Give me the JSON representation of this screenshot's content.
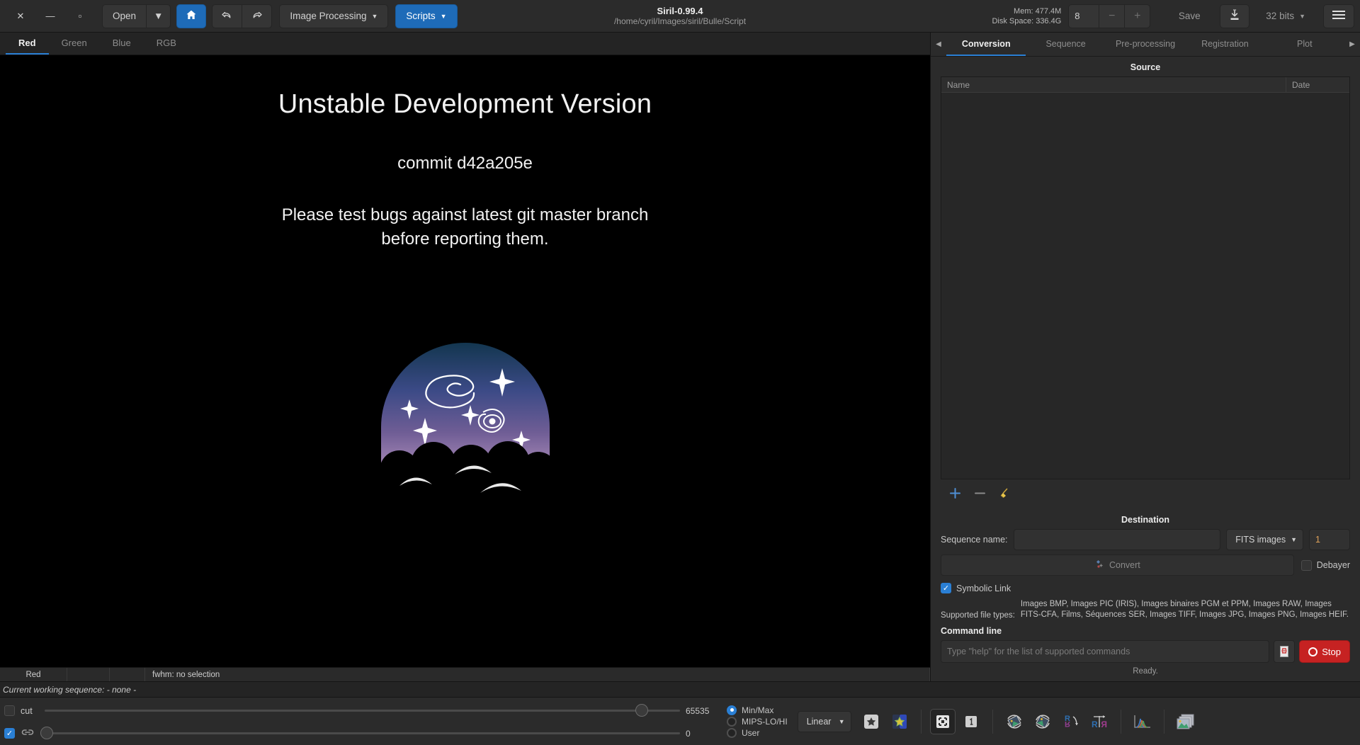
{
  "window": {
    "close_label": "✕",
    "minimize_label": "—",
    "maximize_label": "▫",
    "title": "Siril-0.99.4",
    "subtitle": "/home/cyril/Images/siril/Bulle/Script"
  },
  "toolbar": {
    "open_label": "Open",
    "open_dropdown_label": "▼",
    "home_icon": "home-icon",
    "undo_icon": "undo-icon",
    "redo_icon": "redo-icon",
    "image_processing_label": "Image Processing",
    "scripts_label": "Scripts",
    "caret": "▼"
  },
  "header_right": {
    "mem_label": "Mem: 477.4M",
    "disk_label": "Disk Space: 336.4G",
    "spin_value": "8",
    "minus_label": "−",
    "plus_label": "+",
    "save_label": "Save",
    "saveas_icon": "save-as-icon",
    "bitdepth_label": "32 bits",
    "bitdepth_caret": "▼",
    "menu_icon": "hamburger-menu-icon"
  },
  "channel_tabs": [
    {
      "label": "Red",
      "active": true
    },
    {
      "label": "Green",
      "active": false
    },
    {
      "label": "Blue",
      "active": false
    },
    {
      "label": "RGB",
      "active": false
    }
  ],
  "splash": {
    "headline": "Unstable Development Version",
    "commit": "commit d42a205e",
    "notice_line1": "Please test bugs against latest git master branch",
    "notice_line2": "before reporting them.",
    "logo_name": "siril-logo"
  },
  "image_status": {
    "channel": "Red",
    "col2": "",
    "col3": "",
    "fwhm": "fwhm: no selection"
  },
  "panel_tabs": {
    "prev_arrow": "◀",
    "next_arrow": "▶",
    "items": [
      {
        "label": "Conversion",
        "active": true
      },
      {
        "label": "Sequence",
        "active": false
      },
      {
        "label": "Pre-processing",
        "active": false
      },
      {
        "label": "Registration",
        "active": false
      },
      {
        "label": "Plot",
        "active": false
      }
    ]
  },
  "source": {
    "title": "Source",
    "columns": [
      "Name",
      "Date"
    ],
    "rows": [],
    "add_icon": "plus-icon",
    "remove_icon": "minus-icon",
    "clear_icon": "broom-icon"
  },
  "destination": {
    "title": "Destination",
    "sequence_name_label": "Sequence name:",
    "sequence_name_value": "",
    "sequence_name_placeholder": "",
    "format_value": "FITS images",
    "format_caret": "▼",
    "start_index": "1",
    "convert_label": "Convert",
    "convert_icon": "convert-icon",
    "debayer_label": "Debayer",
    "debayer_checked": false,
    "symbolic_link_label": "Symbolic Link",
    "symbolic_link_checked": true,
    "supported_label": "Supported file types:",
    "supported_value": "Images BMP, Images PIC (IRIS), Images binaires PGM et PPM, Images RAW, Images FITS-CFA, Films, Séquences SER, Images TIFF, Images JPG, Images PNG, Images HEIF."
  },
  "command_line": {
    "title": "Command line",
    "placeholder": "Type \"help\" for the list of supported commands",
    "value": "",
    "script_icon": "script-icon",
    "stop_label": "Stop",
    "status": "Ready."
  },
  "sequence_status": {
    "text": "Current working sequence: - none -"
  },
  "bottom": {
    "cut_label": "cut",
    "cut_checked": false,
    "link_checked": true,
    "link_icon": "chain-link-icon",
    "hi_value": "65535",
    "lo_value": "0",
    "hi_percent": 93,
    "lo_percent": 0,
    "display_modes": [
      {
        "label": "Min/Max",
        "selected": true
      },
      {
        "label": "MIPS-LO/HI",
        "selected": false
      },
      {
        "label": "User",
        "selected": false
      }
    ],
    "scale_label": "Linear",
    "scale_caret": "▼",
    "tools": [
      {
        "name": "star-outline-icon"
      },
      {
        "name": "star-color-icon"
      },
      {
        "name": "fit-to-window-icon",
        "framed": true
      },
      {
        "name": "zoom-one-to-one-icon"
      },
      {
        "name": "rotate-left-icon"
      },
      {
        "name": "rotate-right-icon"
      },
      {
        "name": "flip-vertical-icon"
      },
      {
        "name": "flip-horizontal-icon"
      },
      {
        "name": "histogram-icon"
      },
      {
        "name": "image-stack-icon"
      }
    ]
  },
  "colors": {
    "accent": "#2a7fd4",
    "stop_red": "#c62222",
    "panel_bg": "#2b2b2b",
    "canvas_bg": "#000000"
  }
}
